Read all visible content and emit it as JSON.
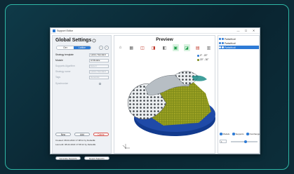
{
  "window": {
    "title": "Support Editor",
    "controls": [
      "—",
      "☐",
      "✕"
    ]
  },
  "left_panel": {
    "title": "Global Settings",
    "tabs": [
      "Ger",
      "Lattice"
    ],
    "nav": [
      "‹",
      "›"
    ],
    "fields": [
      {
        "label": "Strategy template",
        "value": "Lattice Standard",
        "enabled": true
      },
      {
        "label": "Module",
        "value": "AI Module",
        "enabled": true
      },
      {
        "label": "Supports Algorithm",
        "value": "Expert",
        "enabled": false
      },
      {
        "label": "Strategy name",
        "value": "Lattice Standard",
        "enabled": false
      },
      {
        "label": "Tags",
        "value": "Generate",
        "enabled": false
      },
      {
        "label": "Synchronize",
        "value": "",
        "enabled": false
      }
    ],
    "buttons": [
      "New",
      "Add",
      "Delete"
    ],
    "created": "Created: 08-02-2022 17:08:12 by DefaultE",
    "edited": "Last edit: 08-02-2022 17:08:12 by DefaultE",
    "actions": [
      "Generate Supports",
      "Export Supports"
    ]
  },
  "preview": {
    "title": "Preview",
    "tools": [
      "⌂",
      "▦",
      "◫",
      "◨",
      "◧",
      "▣",
      "◪",
      "▤",
      "▥"
    ],
    "legend": [
      {
        "label": "0° - 20°",
        "color": "#2d7bd6"
      },
      {
        "label": "20° - 30°",
        "color": "#7a8a1e"
      }
    ]
  },
  "right_panel": {
    "objects": [
      {
        "label": "Partwith.stl",
        "selected": false
      },
      {
        "label": "Partwith.stl",
        "selected": false
      },
      {
        "label": "Partwith.stl",
        "selected": true
      }
    ],
    "visibility": [
      "Models",
      "Supports",
      "Overhangs"
    ],
    "layer_value": "1",
    "slider_level": 0.55
  },
  "colors": {
    "accent": "#2d7bd6",
    "frame": "#2fb7a6",
    "platform": "#1f4aa8",
    "supports": "#a7a21c"
  }
}
